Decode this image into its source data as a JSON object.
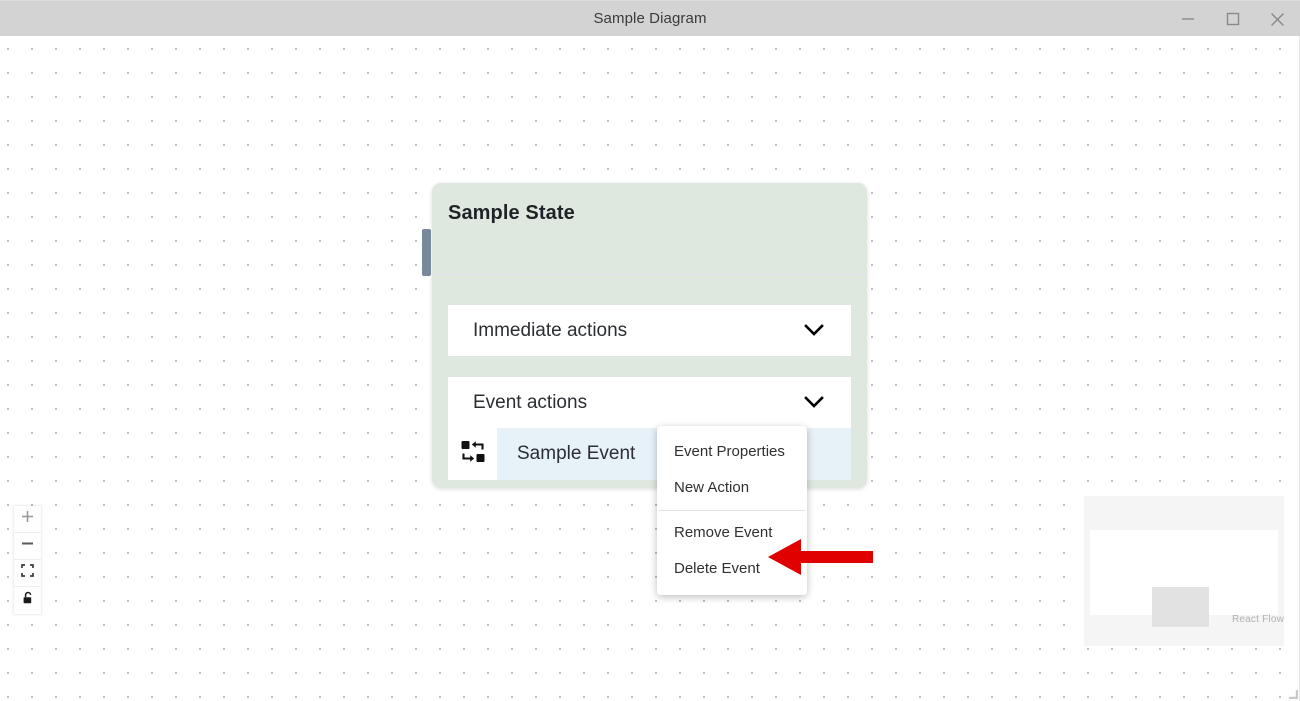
{
  "window": {
    "title": "Sample Diagram",
    "controls": [
      {
        "name": "minimize",
        "label": "Minimize"
      },
      {
        "name": "maximize",
        "label": "Maximize"
      },
      {
        "name": "close",
        "label": "Close"
      }
    ]
  },
  "canvas": {
    "background_style": "dots",
    "dot_color": "#a8abaf",
    "background_color": "#ffffff"
  },
  "node": {
    "title": "Sample State",
    "background_color": "#dfe8df",
    "handle_color": "#78899e",
    "sections": [
      {
        "label": "Immediate actions",
        "icon": "chevron-down-icon",
        "expanded": false
      },
      {
        "label": "Event actions",
        "icon": "chevron-down-icon",
        "expanded": true
      }
    ],
    "events": [
      {
        "label": "Sample Event",
        "icon": "event-swap-icon",
        "row_color": "#e7f1f8"
      }
    ]
  },
  "context_menu": {
    "items": [
      {
        "label": "Event Properties",
        "divider_after": false
      },
      {
        "label": "New Action",
        "divider_after": true
      },
      {
        "label": "Remove Event",
        "divider_after": false
      },
      {
        "label": "Delete Event",
        "divider_after": false
      }
    ]
  },
  "annotation": {
    "arrow_color": "#e00000",
    "points_to": "Delete Event"
  },
  "controls": {
    "buttons": [
      {
        "name": "zoom-in",
        "label": "zoom in"
      },
      {
        "name": "zoom-out",
        "label": "zoom out"
      },
      {
        "name": "fit-view",
        "label": "fit view"
      },
      {
        "name": "toggle-interactivity",
        "label": "toggle interactivity"
      }
    ]
  },
  "minimap": {
    "attribution": "React Flow",
    "background_color": "#f5f5f5",
    "viewport_color": "#ffffff",
    "node_color": "#e2e2e2"
  }
}
